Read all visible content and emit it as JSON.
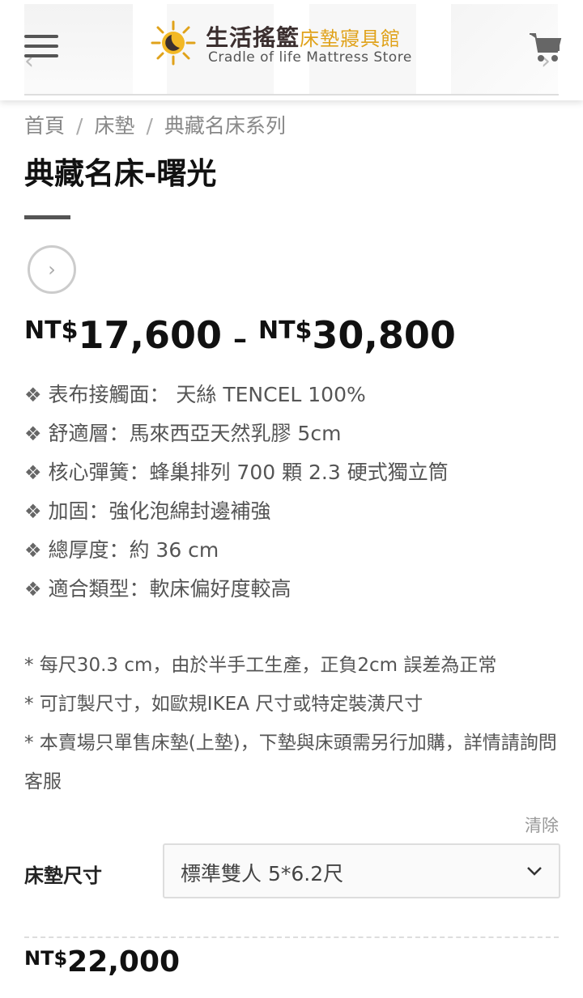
{
  "header": {
    "logo_cn": "生活搖籃",
    "logo_cn_sub": "床墊寢具館",
    "logo_en": "Cradle of life Mattress Store"
  },
  "breadcrumb": [
    "首頁",
    "床墊",
    "典藏名床系列"
  ],
  "breadcrumb_sep": "/",
  "product": {
    "title": "典藏名床-曙光",
    "price_currency": "NT$",
    "price_min": "17,600",
    "price_max": "30,800",
    "price_dash": "–"
  },
  "features_bullet": "❖",
  "features": [
    "表布接觸面： 天絲 TENCEL 100%",
    "舒適層：馬來西亞天然乳膠 5cm",
    "核心彈簧：蜂巢排列 700 顆 2.3 硬式獨立筒",
    "加固：強化泡綿封邊補強",
    "總厚度：約 36 cm",
    "適合類型：軟床偏好度較高"
  ],
  "notes": [
    "* 每尺30.3 cm，由於半手工生產，正負2cm 誤差為正常",
    "* 可訂製尺寸，如歐規IKEA 尺寸或特定裝潢尺寸",
    "* 本賣場只單售床墊(上墊)，下墊與床頭需另行加購，詳情請詢問客服"
  ],
  "variation": {
    "clear_label": "清除",
    "size_label": "床墊尺寸",
    "selected": "標準雙人 5*6.2尺"
  },
  "selected_price": {
    "currency": "NT$",
    "amount": "22,000"
  },
  "colors": {
    "accent_gold": "#e0a21a",
    "text_dark": "#111111",
    "text_muted": "#555555"
  }
}
